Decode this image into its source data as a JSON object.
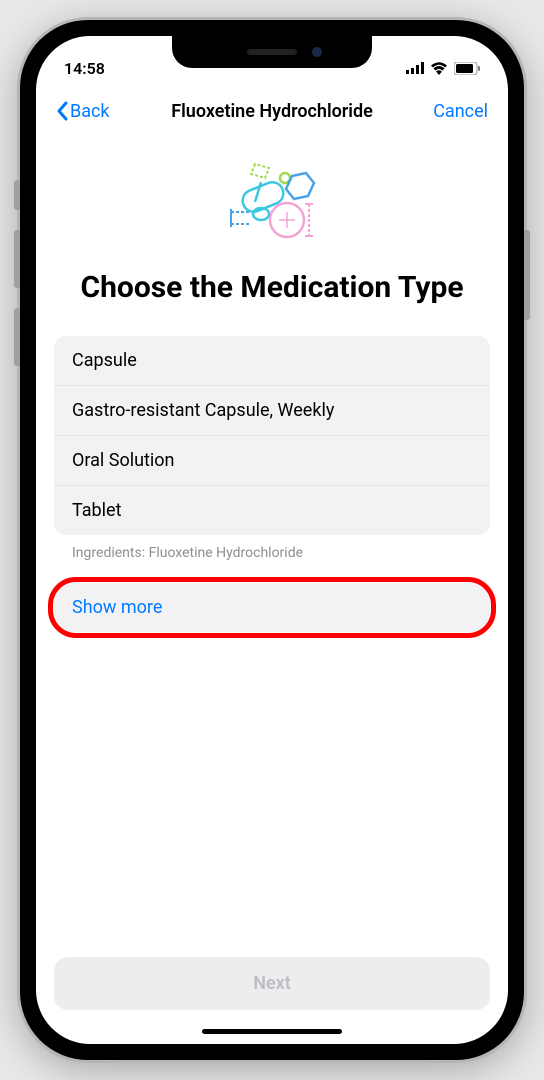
{
  "status": {
    "time": "14:58"
  },
  "nav": {
    "back": "Back",
    "title": "Fluoxetine Hydrochloride",
    "cancel": "Cancel"
  },
  "heading": "Choose the Medication Type",
  "options": [
    "Capsule",
    "Gastro-resistant Capsule, Weekly",
    "Oral Solution",
    "Tablet"
  ],
  "ingredients_label": "Ingredients:",
  "ingredients_value": "Fluoxetine Hydrochloride",
  "show_more": "Show more",
  "next": "Next"
}
